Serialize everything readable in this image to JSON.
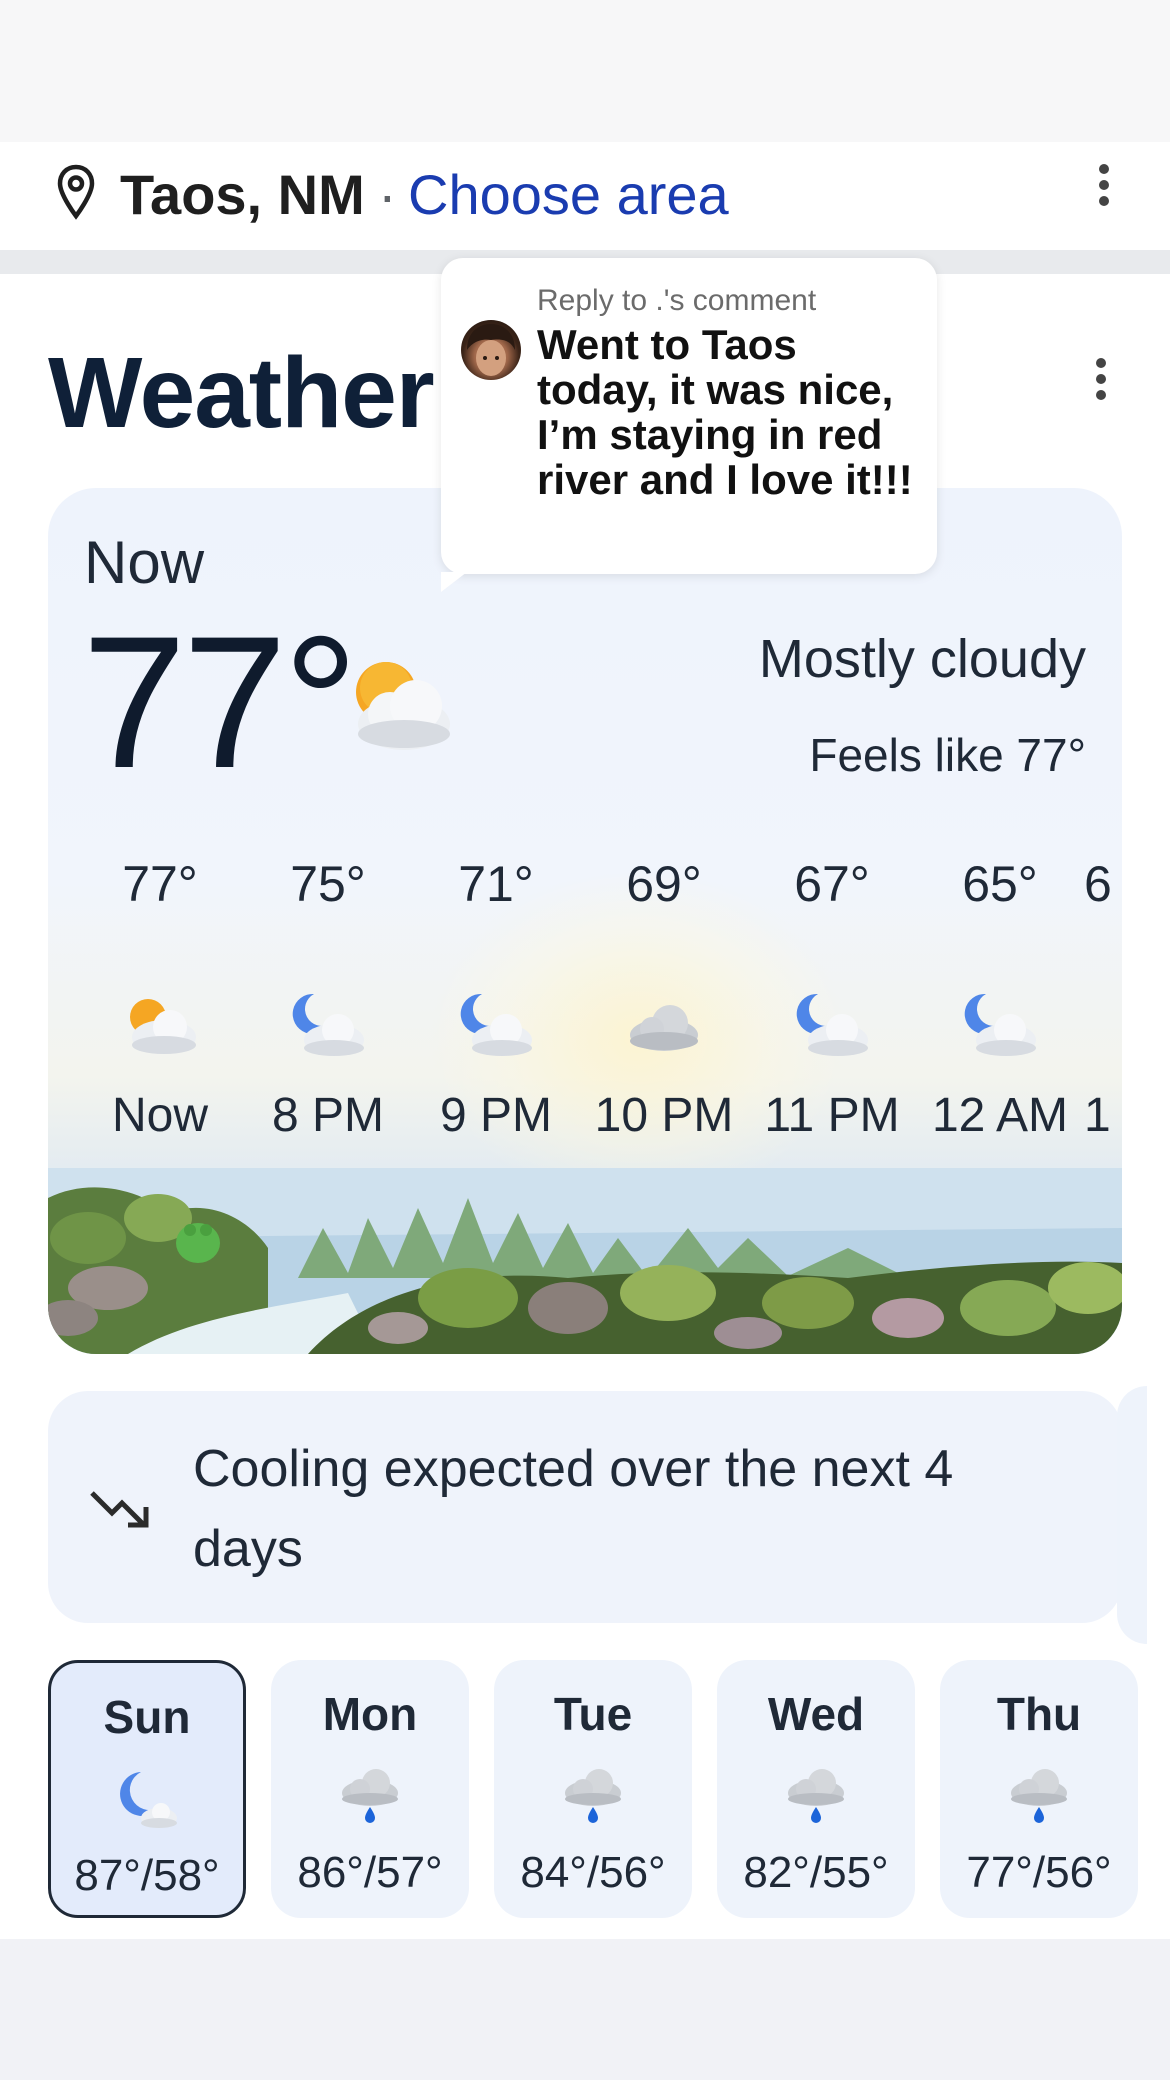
{
  "location": {
    "name": "Taos, NM",
    "separator": "·",
    "choose_area": "Choose area",
    "pin_icon": "location-pin-icon",
    "menu_icon": "more-vert-icon"
  },
  "weather": {
    "title": "Weather",
    "menu_icon": "more-vert-icon",
    "now_label": "Now",
    "temperature": "77°",
    "condition": "Mostly cloudy",
    "feels_like": "Feels like 77°",
    "condition_icon": "partly-cloudy-day-icon"
  },
  "hourly": [
    {
      "temp": "77°",
      "time": "Now",
      "icon": "partly-cloudy-day-icon"
    },
    {
      "temp": "75°",
      "time": "8 PM",
      "icon": "partly-cloudy-night-icon"
    },
    {
      "temp": "71°",
      "time": "9 PM",
      "icon": "partly-cloudy-night-icon"
    },
    {
      "temp": "69°",
      "time": "10 PM",
      "icon": "cloudy-icon"
    },
    {
      "temp": "67°",
      "time": "11 PM",
      "icon": "partly-cloudy-night-icon"
    },
    {
      "temp": "65°",
      "time": "12 AM",
      "icon": "partly-cloudy-night-icon"
    },
    {
      "temp": "6",
      "time": "1",
      "icon": "partly-cloudy-night-icon"
    }
  ],
  "insight": {
    "text": "Cooling expected over the next 4 days",
    "icon": "trending-down-icon"
  },
  "daily": [
    {
      "day": "Sun",
      "temps": "87°/58°",
      "icon": "partly-cloudy-night-icon",
      "selected": true
    },
    {
      "day": "Mon",
      "temps": "86°/57°",
      "icon": "rain-icon",
      "selected": false
    },
    {
      "day": "Tue",
      "temps": "84°/56°",
      "icon": "rain-icon",
      "selected": false
    },
    {
      "day": "Wed",
      "temps": "82°/55°",
      "icon": "rain-icon",
      "selected": false
    },
    {
      "day": "Thu",
      "temps": "77°/56°",
      "icon": "rain-icon",
      "selected": false
    }
  ],
  "comment_popover": {
    "reply_to": "Reply to .'s comment",
    "text": "Went to Taos today, it was nice, I’m staying in red river and I love it!!!",
    "avatar": "avatar"
  },
  "colors": {
    "link": "#1a3cb0",
    "title": "#0f2038",
    "card_bg": "#eef3fb",
    "selected_border": "#1f2937"
  }
}
